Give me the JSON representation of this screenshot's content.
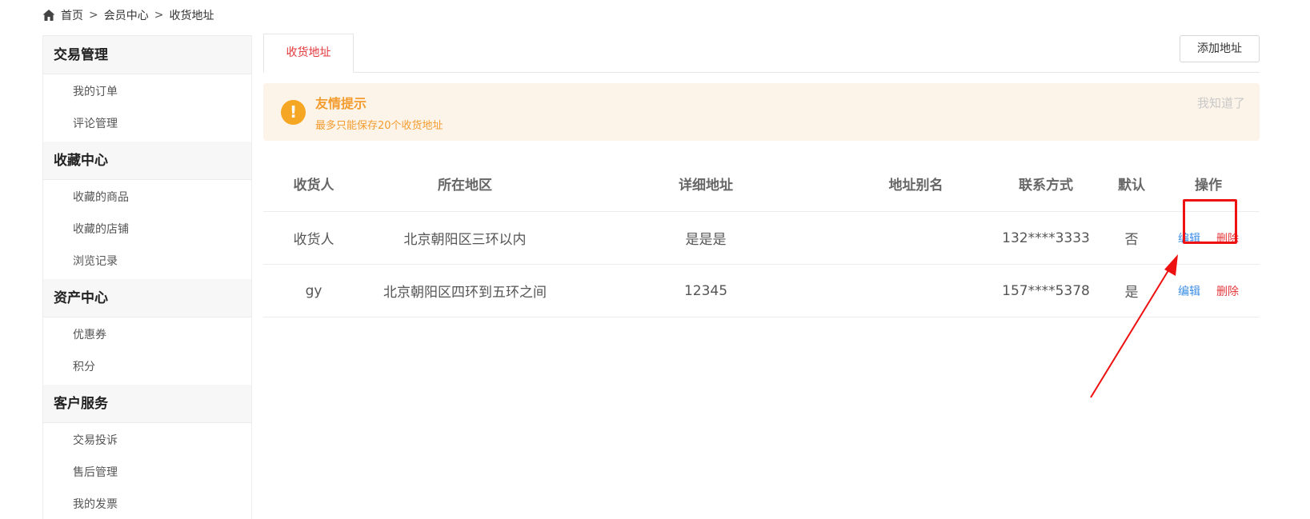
{
  "breadcrumb": {
    "items": [
      "首页",
      "会员中心",
      "收货地址"
    ],
    "separator": ">"
  },
  "sidebar": {
    "groups": [
      {
        "title": "交易管理",
        "items": [
          "我的订单",
          "评论管理"
        ]
      },
      {
        "title": "收藏中心",
        "items": [
          "收藏的商品",
          "收藏的店铺",
          "浏览记录"
        ]
      },
      {
        "title": "资产中心",
        "items": [
          "优惠券",
          "积分"
        ]
      },
      {
        "title": "客户服务",
        "items": [
          "交易投诉",
          "售后管理",
          "我的发票"
        ]
      }
    ]
  },
  "main": {
    "tab_label": "收货地址",
    "add_button": "添加地址",
    "tip": {
      "title": "友情提示",
      "desc": "最多只能保存20个收货地址",
      "dismiss": "我知道了",
      "icon": "!"
    },
    "table": {
      "headers": [
        "收货人",
        "所在地区",
        "详细地址",
        "地址别名",
        "联系方式",
        "默认",
        "操作"
      ],
      "rows": [
        {
          "receiver": "收货人",
          "region": "北京朝阳区三环以内",
          "detail": "是是是",
          "alias": "",
          "phone": "132****3333",
          "default": "否",
          "edit": "编辑",
          "delete": "删除"
        },
        {
          "receiver": "gy",
          "region": "北京朝阳区四环到五环之间",
          "detail": "12345",
          "alias": "",
          "phone": "157****5378",
          "default": "是",
          "edit": "编辑",
          "delete": "删除"
        }
      ]
    }
  },
  "colors": {
    "accent_red": "#e4393c",
    "link_blue": "#3a8ee6",
    "tip_orange": "#f39c2f",
    "annotation_red": "#ee1111"
  }
}
